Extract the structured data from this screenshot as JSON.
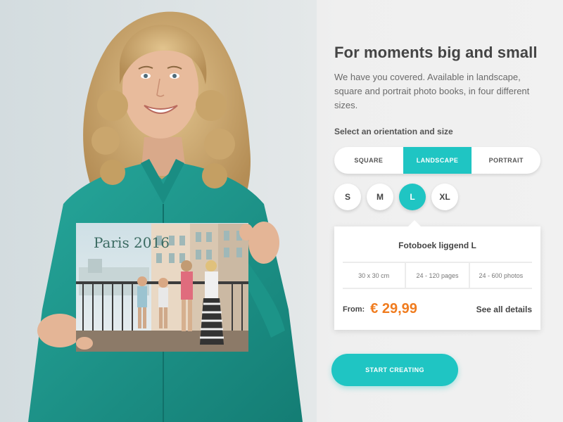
{
  "hero": {
    "book_cover_text": "Paris 2016",
    "icon": "person-holding-photo-book"
  },
  "header": {
    "title": "For moments big and small",
    "description": "We have you covered. Available in landscape, square and portrait photo books, in four different sizes."
  },
  "selector": {
    "label": "Select an orientation and size",
    "orientations": [
      {
        "label": "SQUARE",
        "active": false
      },
      {
        "label": "LANDSCAPE",
        "active": true
      },
      {
        "label": "PORTRAIT",
        "active": false
      }
    ],
    "sizes": [
      {
        "label": "S",
        "active": false
      },
      {
        "label": "M",
        "active": false
      },
      {
        "label": "L",
        "active": true
      },
      {
        "label": "XL",
        "active": false
      }
    ]
  },
  "product": {
    "name": "Fotoboek liggend L",
    "specs": [
      "30 x 30 cm",
      "24 - 120 pages",
      "24 - 600  photos"
    ],
    "from_label": "From:",
    "price": "€ 29,99",
    "details_link": "See all details"
  },
  "cta": {
    "label": "START CREATING"
  },
  "colors": {
    "accent": "#1fc5c3",
    "price": "#f07c1f",
    "shirt": "#1e9a8f"
  }
}
